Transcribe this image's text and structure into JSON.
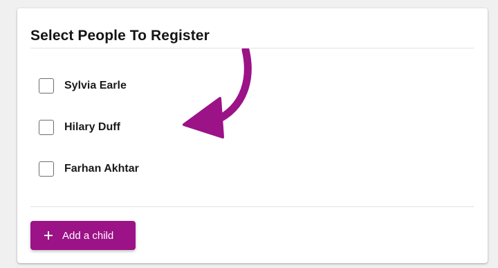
{
  "card": {
    "title": "Select People To Register"
  },
  "people": [
    {
      "name": "Sylvia Earle",
      "checked": false
    },
    {
      "name": "Hilary Duff",
      "checked": false
    },
    {
      "name": "Farhan Akhtar",
      "checked": false
    }
  ],
  "actions": {
    "add_child_label": "Add a child",
    "add_child_icon": "plus-icon"
  },
  "annotation": {
    "icon": "curved-arrow-icon",
    "color": "#9c1287"
  },
  "colors": {
    "accent": "#9c1287",
    "background": "#f0f0f0",
    "card": "#ffffff"
  }
}
